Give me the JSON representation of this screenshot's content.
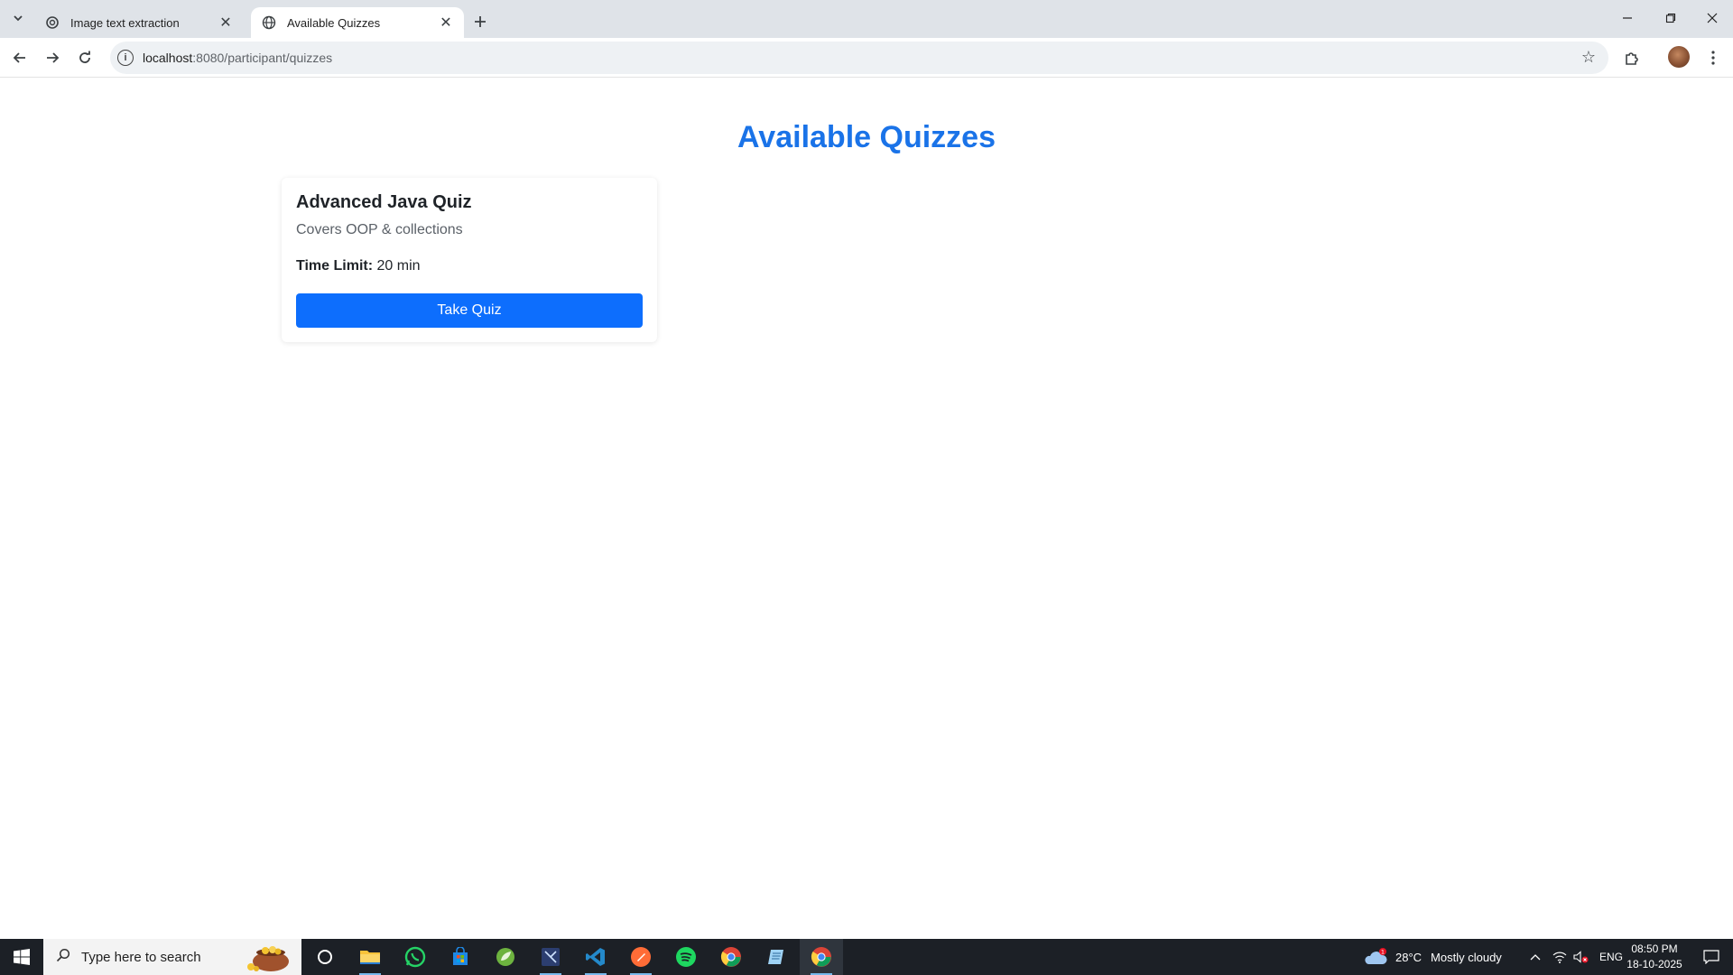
{
  "browser": {
    "tabs": [
      {
        "title": "Image text extraction",
        "active": false
      },
      {
        "title": "Available Quizzes",
        "active": true
      }
    ],
    "url_host": "localhost",
    "url_rest": ":8080/participant/quizzes"
  },
  "page": {
    "title": "Available Quizzes",
    "quizzes": [
      {
        "name": "Advanced Java Quiz",
        "description": "Covers OOP & collections",
        "time_label": "Time Limit:",
        "time_value": "20 min",
        "button_label": "Take Quiz"
      }
    ]
  },
  "taskbar": {
    "search_placeholder": "Type here to search",
    "weather_temp": "28°C",
    "weather_desc": "Mostly cloudy",
    "weather_badge": "1",
    "language": "ENG",
    "time": "08:50 PM",
    "date": "18-10-2025"
  },
  "colors": {
    "title_blue": "#1a73e8",
    "button_blue": "#0d6efd"
  }
}
